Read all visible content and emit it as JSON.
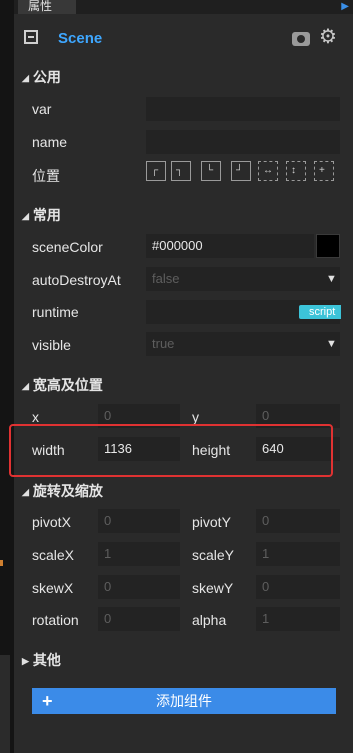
{
  "tab": {
    "label": "属性"
  },
  "scene": {
    "title": "Scene"
  },
  "sections": {
    "common": "公用",
    "general": "常用",
    "size": "宽高及位置",
    "transform": "旋转及缩放",
    "other": "其他"
  },
  "fields": {
    "var": {
      "label": "var",
      "value": ""
    },
    "name": {
      "label": "name",
      "value": ""
    },
    "position": {
      "label": "位置"
    },
    "sceneColor": {
      "label": "sceneColor",
      "value": "#000000",
      "swatch": "#000000"
    },
    "autoDestroyAt": {
      "label": "autoDestroyAt",
      "value": "false"
    },
    "runtime": {
      "label": "runtime",
      "value": "",
      "tag": "script"
    },
    "visible": {
      "label": "visible",
      "value": "true"
    },
    "x": {
      "label": "x",
      "value": "0"
    },
    "y": {
      "label": "y",
      "value": "0"
    },
    "width": {
      "label": "width",
      "value": "1136"
    },
    "height": {
      "label": "height",
      "value": "640"
    },
    "pivotX": {
      "label": "pivotX",
      "value": "0"
    },
    "pivotY": {
      "label": "pivotY",
      "value": "0"
    },
    "scaleX": {
      "label": "scaleX",
      "value": "1"
    },
    "scaleY": {
      "label": "scaleY",
      "value": "1"
    },
    "skewX": {
      "label": "skewX",
      "value": "0"
    },
    "skewY": {
      "label": "skewY",
      "value": "0"
    },
    "rotation": {
      "label": "rotation",
      "value": "0"
    },
    "alpha": {
      "label": "alpha",
      "value": "1"
    }
  },
  "add_component": {
    "label": "添加组件"
  },
  "colors": {
    "accent": "#3ea7ff",
    "button": "#3b8be8",
    "highlight": "#e03232",
    "script_tag": "#3cc3d8"
  }
}
